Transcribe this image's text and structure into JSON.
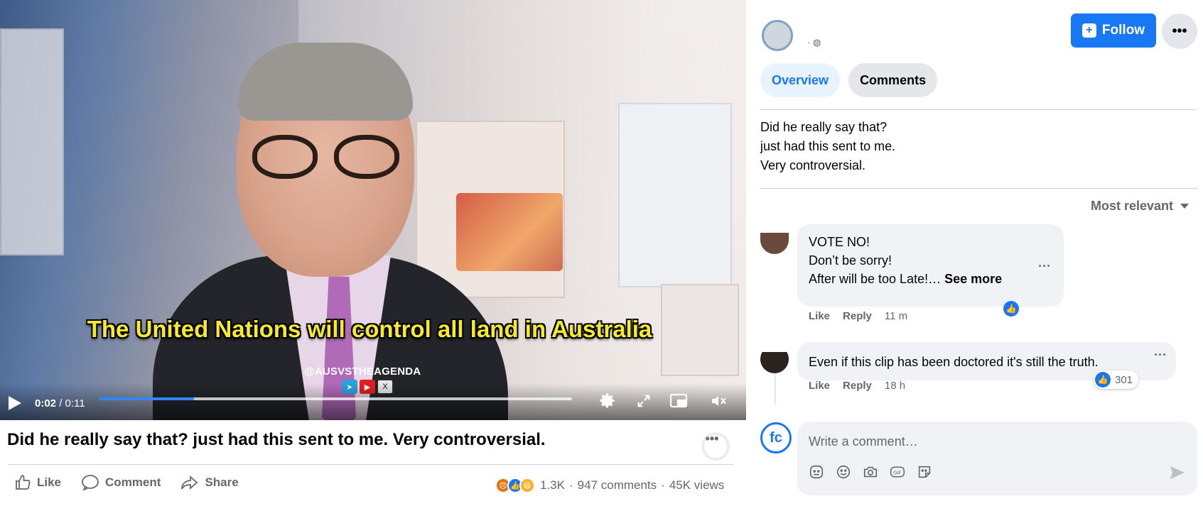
{
  "video": {
    "subtitle": "The United Nations will control all land in Australia",
    "watermark": "@AUSVSTHEAGENDA",
    "current_time": "0:02",
    "duration": "/ 0:11",
    "progress": 0.2
  },
  "post": {
    "title": "Did he really say that? just had this sent to me. Very controversial.",
    "actions": {
      "like": "Like",
      "comment": "Comment",
      "share": "Share"
    },
    "stats": {
      "reactions": "1.3K",
      "comments": "947 comments",
      "views": "45K views"
    }
  },
  "panel": {
    "follow_label": "Follow",
    "tabs": [
      {
        "label": "Overview"
      },
      {
        "label": "Comments"
      }
    ],
    "description": [
      "Did he really say that?",
      "just had this sent to me.",
      "Very controversial."
    ],
    "sort_label": "Most relevant",
    "comments": [
      {
        "lines": [
          "VOTE NO!",
          "Don’t be sorry!",
          "After will be too Late!… "
        ],
        "see_more": "See more",
        "like": "Like",
        "reply": "Reply",
        "time": "11 m"
      },
      {
        "text": "Even if this clip has been doctored it's still the truth.",
        "like": "Like",
        "reply": "Reply",
        "time": "18 h",
        "like_count": "301"
      }
    ],
    "composer": {
      "placeholder": "Write a comment…"
    }
  },
  "colors": {
    "accent": "#1877f2",
    "subtitle": "#f7ea2b"
  }
}
